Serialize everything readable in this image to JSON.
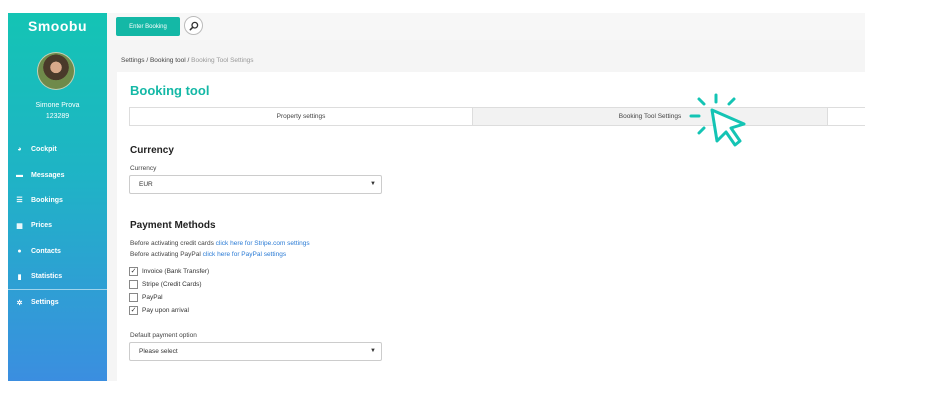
{
  "app": {
    "logo": "Smoobu"
  },
  "topbar": {
    "enter_booking_label": "Enter Booking",
    "search_icon": "search-icon"
  },
  "user": {
    "name": "Simone Prova",
    "id": "123289"
  },
  "sidebar": {
    "items": [
      {
        "label": "Cockpit",
        "icon": "dashboard-icon"
      },
      {
        "label": "Messages",
        "icon": "envelope-icon"
      },
      {
        "label": "Bookings",
        "icon": "list-icon"
      },
      {
        "label": "Prices",
        "icon": "calculator-icon"
      },
      {
        "label": "Contacts",
        "icon": "users-icon"
      },
      {
        "label": "Statistics",
        "icon": "bar-chart-icon"
      },
      {
        "label": "Settings",
        "icon": "gear-icon"
      }
    ]
  },
  "breadcrumb": {
    "item1": "Settings",
    "sep": "/",
    "item2": "Booking tool",
    "current": "Booking Tool Settings"
  },
  "page": {
    "title": "Booking tool"
  },
  "tabs": [
    {
      "label": "Property settings"
    },
    {
      "label": "Booking Tool Settings"
    },
    {
      "label": ""
    }
  ],
  "currency": {
    "section_title": "Currency",
    "label": "Currency",
    "value": "EUR"
  },
  "payment": {
    "section_title": "Payment Methods",
    "note1_prefix": "Before activating credit cards",
    "note1_link": "click here for Stripe.com settings",
    "note2_prefix": "Before activating PayPal",
    "note2_link": "click here for PayPal settings",
    "options": [
      {
        "label": "Invoice (Bank Transfer)",
        "checked": true
      },
      {
        "label": "Stripe (Credit Cards)",
        "checked": false
      },
      {
        "label": "PayPal",
        "checked": false
      },
      {
        "label": "Pay upon arrival",
        "checked": true
      }
    ],
    "default_label": "Default payment option",
    "default_placeholder": "Please select"
  },
  "colors": {
    "accent": "#14b8a6",
    "link": "#2a7bd5"
  }
}
